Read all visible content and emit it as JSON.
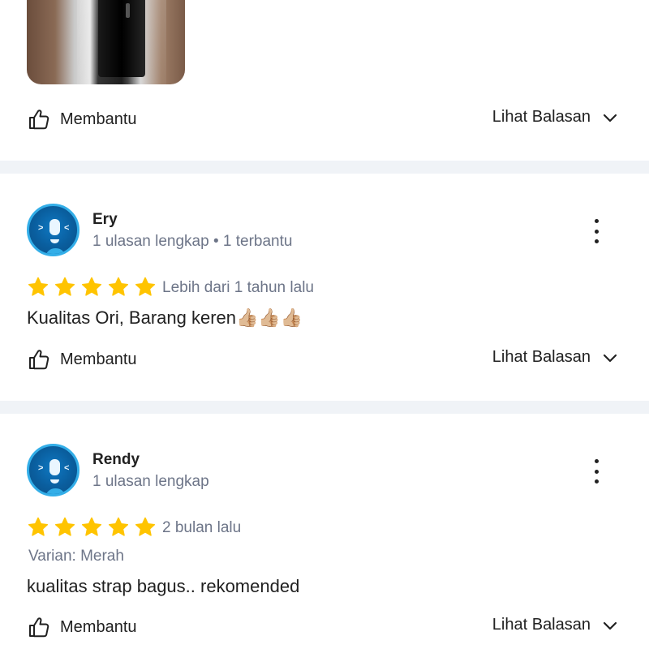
{
  "top_review": {
    "photo_alt": "review photo",
    "helpful_label": "Membantu",
    "replies_label": "Lihat Balasan"
  },
  "reviews": [
    {
      "name": "Ery",
      "meta": "1 ulasan lengkap • 1 terbantu",
      "rating": 5,
      "time": "Lebih dari 1 tahun lalu",
      "text": "Kualitas Ori, Barang keren👍🏼👍🏼👍🏼",
      "helpful_label": "Membantu",
      "replies_label": "Lihat Balasan"
    },
    {
      "name": "Rendy",
      "meta": "1 ulasan lengkap",
      "rating": 5,
      "time": "2 bulan lalu",
      "variant": "Varian: Merah",
      "text": "kualitas strap bagus.. rekomended",
      "helpful_label": "Membantu",
      "replies_label": "Lihat Balasan"
    }
  ],
  "colors": {
    "star": "#ffc400",
    "separator": "#f0f3f7",
    "muted_text": "#6d7588",
    "avatar_ring": "#33aee8"
  },
  "icons": {
    "helpful": "thumbs-up-icon",
    "replies": "chevron-down-icon",
    "menu": "kebab-menu-icon",
    "star": "star-icon"
  }
}
